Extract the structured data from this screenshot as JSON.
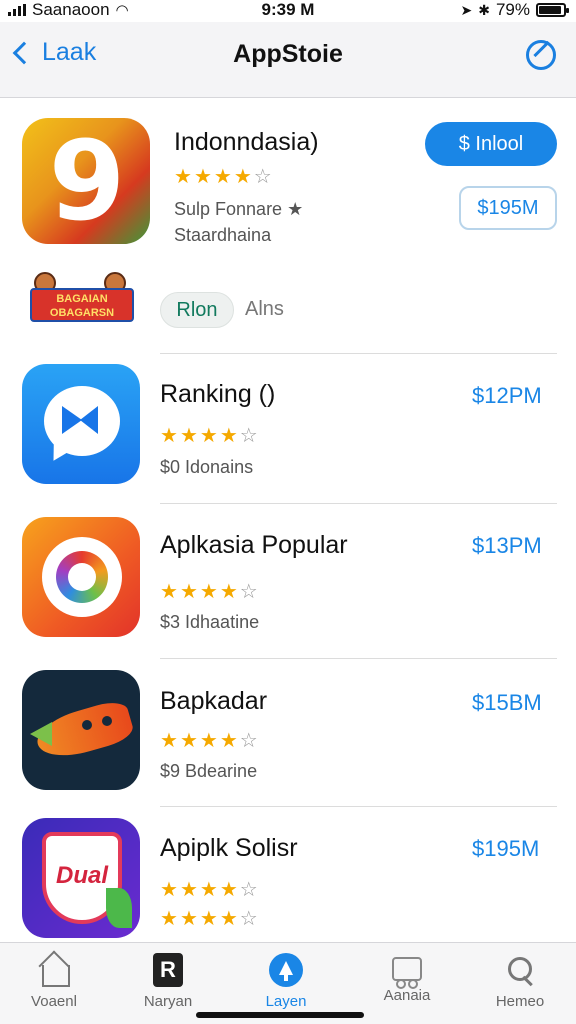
{
  "status_bar": {
    "carrier": "Saanaoon",
    "time": "9:39 M",
    "battery": "79%"
  },
  "navbar": {
    "back_label": "Laak",
    "title": "AppStoie"
  },
  "featured": {
    "title": "Indonndasia)",
    "rating": 4,
    "subtitle1": "Sulp Fonnare ★",
    "subtitle2": "Staardhaina",
    "install_label": "$ Inlool",
    "price_label": "$195M"
  },
  "tags": {
    "banner_text": "BAGAIAN OBAGARSN",
    "chip_label": "Rlon",
    "alt_label": "Alns"
  },
  "list": [
    {
      "title": "Ranking ()",
      "price": "$12PM",
      "rating": 4,
      "subtitle": "$0 Idonains"
    },
    {
      "title": "Aplkasia Popular",
      "price": "$13PM",
      "rating": 4,
      "subtitle": "$3 Idhaatine"
    },
    {
      "title": "Bapkadar",
      "price": "$15BM",
      "rating": 4,
      "subtitle": "$9 Bdearine"
    },
    {
      "title": "Apiplk Solisr",
      "price": "$195M",
      "rating": 4,
      "subtitle": ""
    }
  ],
  "shield_icon_text": "Dual",
  "tabs": [
    {
      "label": "Voaenl",
      "icon": "home-icon"
    },
    {
      "label": "Naryan",
      "icon": "today-icon"
    },
    {
      "label": "Layen",
      "icon": "apps-icon"
    },
    {
      "label": "Aanaia",
      "icon": "arcade-icon"
    },
    {
      "label": "Hemeo",
      "icon": "search-icon"
    }
  ],
  "colors": {
    "accent": "#1a86e6",
    "star": "#f5a900"
  }
}
